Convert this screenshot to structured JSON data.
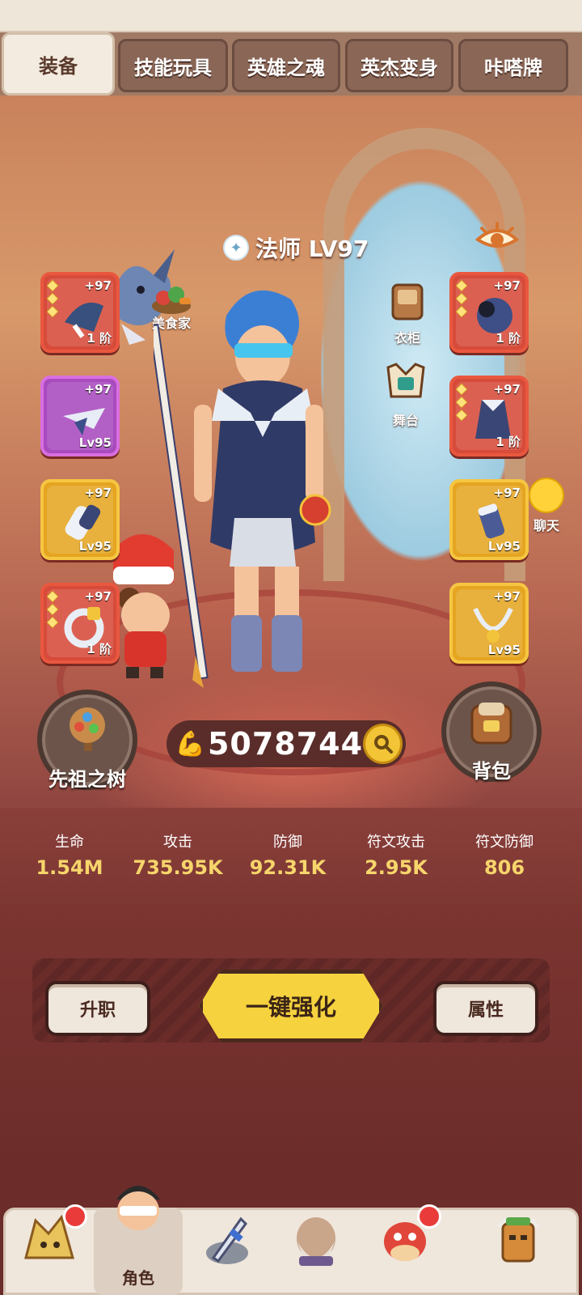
{
  "tabs": [
    {
      "label": "装备",
      "active": true
    },
    {
      "label": "技能玩具",
      "active": false
    },
    {
      "label": "英雄之魂",
      "active": false
    },
    {
      "label": "英杰变身",
      "active": false
    },
    {
      "label": "咔嗒牌",
      "active": false
    }
  ],
  "character": {
    "title": "法师 LV97",
    "class_icon": "mage-class-icon"
  },
  "side_icons": {
    "food": "美食家",
    "wardrobe": "衣柜",
    "stage": "舞台",
    "chat": "聊天"
  },
  "slots_left": [
    {
      "plus": "+97",
      "level": "1 阶",
      "rarity": "red",
      "stars": 3
    },
    {
      "plus": "+97",
      "level": "Lv95",
      "rarity": "purple",
      "stars": 0
    },
    {
      "plus": "+97",
      "level": "Lv95",
      "rarity": "gold",
      "stars": 0
    },
    {
      "plus": "+97",
      "level": "1 阶",
      "rarity": "red",
      "stars": 3
    }
  ],
  "slots_right": [
    {
      "plus": "+97",
      "level": "1 阶",
      "rarity": "red",
      "stars": 3
    },
    {
      "plus": "+97",
      "level": "1 阶",
      "rarity": "red",
      "stars": 3
    },
    {
      "plus": "+97",
      "level": "Lv95",
      "rarity": "gold",
      "stars": 0
    },
    {
      "plus": "+97",
      "level": "Lv95",
      "rarity": "gold",
      "stars": 0
    }
  ],
  "ancestor_tree": "先祖之树",
  "backpack": "背包",
  "combat_power": "5078744",
  "stats": [
    {
      "label": "生命",
      "value": "1.54M"
    },
    {
      "label": "攻击",
      "value": "735.95K"
    },
    {
      "label": "防御",
      "value": "92.31K"
    },
    {
      "label": "符文攻击",
      "value": "2.95K"
    },
    {
      "label": "符文防御",
      "value": "806"
    }
  ],
  "buttons": {
    "promote": "升职",
    "one_key_enhance": "一键强化",
    "attributes": "属性"
  },
  "nav": [
    {
      "label": "",
      "icon": "hay-creature-icon",
      "badge": true
    },
    {
      "label": "角色",
      "icon": "hero-face-icon",
      "badge": false,
      "active": true
    },
    {
      "label": "",
      "icon": "sword-rock-icon",
      "badge": false
    },
    {
      "label": "",
      "icon": "elder-icon",
      "badge": false
    },
    {
      "label": "",
      "icon": "red-dino-icon",
      "badge": true
    },
    {
      "label": "",
      "icon": "totem-icon",
      "badge": false
    }
  ],
  "colors": {
    "accent_gold": "#f5d23e",
    "stat_value": "#f7d56b",
    "background": "#7b3a34",
    "slot_red": "#e9573f",
    "slot_purple": "#d96ee0",
    "slot_gold": "#f6c642"
  }
}
